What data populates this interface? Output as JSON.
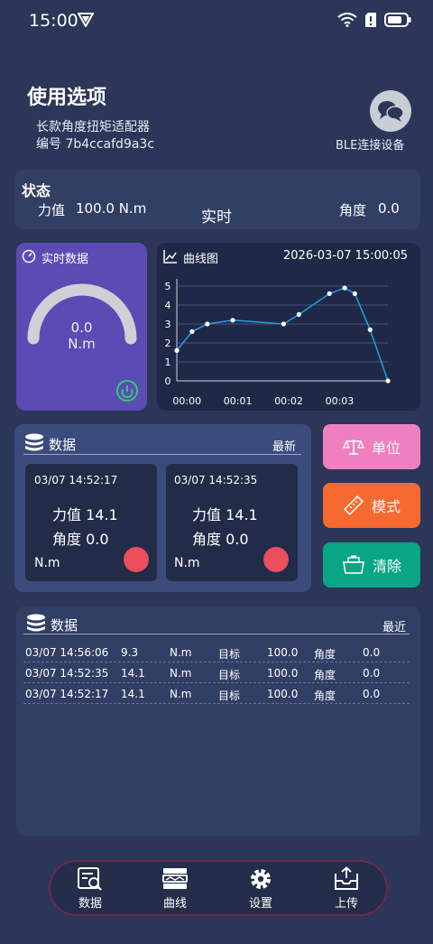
{
  "status_bar": {
    "time": "15:00"
  },
  "header": {
    "title": "使用选项",
    "device_name": "长款角度扭矩适配器",
    "device_id": "编号 7b4ccafd9a3c",
    "ble_label": "BLE连接设备"
  },
  "status": {
    "title": "状态",
    "force_label": "力值",
    "force_value": "100.0 N.m",
    "mode": "实时",
    "angle_label": "角度",
    "angle_value": "0.0"
  },
  "realtime": {
    "title": "实时数据",
    "value": "0.0",
    "unit": "N.m",
    "gauge_fraction": 0.0
  },
  "chart": {
    "title": "曲线图",
    "date": "2026-03-07 15:00:05"
  },
  "chart_data": {
    "type": "line",
    "ylim": [
      0,
      5
    ],
    "y_ticks": [
      "0",
      "1",
      "2",
      "3",
      "4",
      "5"
    ],
    "x_ticks": [
      {
        "label": "00:00",
        "t": 0
      },
      {
        "label": "00:01",
        "t": 1
      },
      {
        "label": "00:02",
        "t": 2
      },
      {
        "label": "00:03",
        "t": 3
      }
    ],
    "xlim": [
      -0.2,
      3.6
    ],
    "points": [
      {
        "t": -0.2,
        "v": 1.6
      },
      {
        "t": 0.1,
        "v": 2.6
      },
      {
        "t": 0.4,
        "v": 3.0
      },
      {
        "t": 0.9,
        "v": 3.2
      },
      {
        "t": 1.9,
        "v": 3.0
      },
      {
        "t": 2.2,
        "v": 3.5
      },
      {
        "t": 2.8,
        "v": 4.6
      },
      {
        "t": 3.1,
        "v": 4.9
      },
      {
        "t": 3.3,
        "v": 4.6
      },
      {
        "t": 3.6,
        "v": 2.7
      },
      {
        "t": 3.95,
        "v": 0.0
      }
    ],
    "line_color": "#1ea0e6",
    "grid": true
  },
  "data_panel": {
    "title": "数据",
    "tag": "最新",
    "entries": [
      {
        "time": "03/07 14:52:17",
        "force": "力值 14.1",
        "angle": "角度 0.0",
        "unit": "N.m"
      },
      {
        "time": "03/07 14:52:35",
        "force": "力值 14.1",
        "angle": "角度 0.0",
        "unit": "N.m"
      }
    ]
  },
  "actions": {
    "unit": "单位",
    "mode": "模式",
    "clear": "清除"
  },
  "history": {
    "title": "数据",
    "tag": "最近",
    "rows": [
      [
        "03/07 14:56:06",
        "9.3",
        "N.m",
        "目标",
        "100.0",
        "角度",
        "0.0"
      ],
      [
        "03/07 14:52:35",
        "14.1",
        "N.m",
        "目标",
        "100.0",
        "角度",
        "0.0"
      ],
      [
        "03/07 14:52:17",
        "14.1",
        "N.m",
        "目标",
        "100.0",
        "角度",
        "0.0"
      ]
    ]
  },
  "nav": {
    "data": "数据",
    "curve": "曲线",
    "settings": "设置",
    "upload": "上传"
  },
  "colors": {
    "background": "#2b3658",
    "realtime_card": "#5b4bb4",
    "unit_button": "#f07fbf",
    "mode_button": "#f6692f",
    "clear_button": "#0aa585",
    "record_dot": "#eb4e5d"
  }
}
